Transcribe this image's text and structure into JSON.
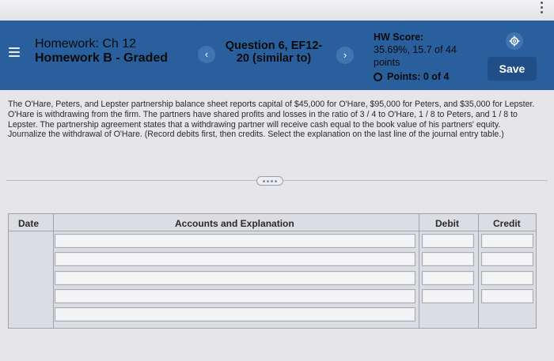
{
  "header": {
    "homework_line1": "Homework: Ch 12",
    "homework_line2": "Homework B - Graded",
    "question_line1": "Question 6, EF12-",
    "question_line2": "20 (similar to)",
    "hw_score_label": "HW Score:",
    "hw_score_value": "35.69%, 15.7 of 44",
    "hw_score_unit": "points",
    "points_label": "Points: 0 of 4",
    "save_label": "Save",
    "prev_icon": "‹",
    "next_icon": "›"
  },
  "problem": {
    "text": "The O'Hare, Peters, and Lepster partnership balance sheet reports capital of $45,000 for O'Hare, $95,000 for Peters, and $35,000 for Lepster. O'Hare is withdrawing from the firm. The partners have shared profits and losses in the ratio of 3 / 4 to O'Hare, 1 / 8 to Peters, and 1 / 8 to Lepster. The partnership agreement states that a withdrawing partner will receive cash equal to the book value of his partners' equity. Journalize the withdrawal of O'Hare. (Record debits first, then credits. Select the explanation on the last line of the journal entry table.)"
  },
  "journal": {
    "col_date": "Date",
    "col_accounts": "Accounts and Explanation",
    "col_debit": "Debit",
    "col_credit": "Credit",
    "rows": [
      {
        "account": "",
        "debit": "",
        "credit": ""
      },
      {
        "account": "",
        "debit": "",
        "credit": ""
      },
      {
        "account": "",
        "debit": "",
        "credit": ""
      },
      {
        "account": "",
        "debit": "",
        "credit": ""
      },
      {
        "account": ""
      }
    ]
  },
  "icons": {
    "menu": "hamburger-icon",
    "settings": "gear-icon",
    "more": "ellipsis-icon"
  },
  "colors": {
    "header_bg": "#2a5f9e",
    "save_bg": "#1f4f86",
    "page_bg": "#e6e6ea"
  }
}
